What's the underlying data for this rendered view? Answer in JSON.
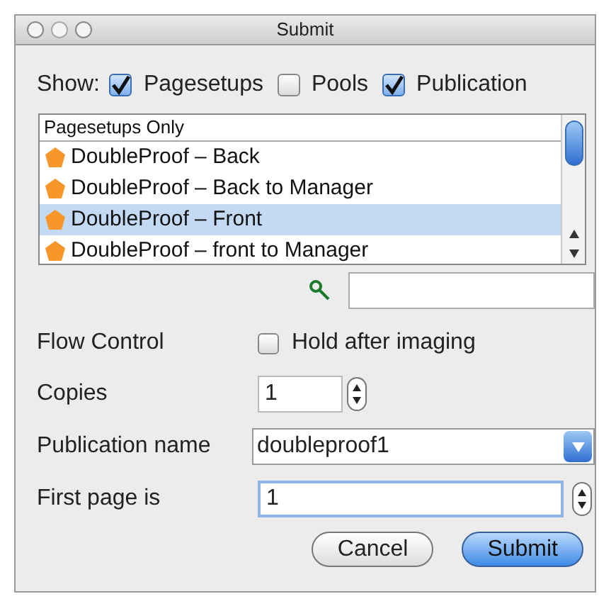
{
  "window": {
    "title": "Submit"
  },
  "show": {
    "label": "Show:",
    "options": [
      {
        "label": "Pagesetups",
        "checked": true
      },
      {
        "label": "Pools",
        "checked": false
      },
      {
        "label": "Publication",
        "checked": true
      }
    ]
  },
  "list": {
    "header": "Pagesetups Only",
    "items": [
      {
        "label": "DoubleProof – Back",
        "selected": false
      },
      {
        "label": "DoubleProof – Back to Manager",
        "selected": false
      },
      {
        "label": "DoubleProof – Front",
        "selected": true
      },
      {
        "label": "DoubleProof – front to Manager",
        "selected": false
      }
    ]
  },
  "flow_control": {
    "label": "Flow Control",
    "checkbox": {
      "label": "Hold after imaging",
      "checked": false
    }
  },
  "copies": {
    "label": "Copies",
    "value": "1"
  },
  "publication_name": {
    "label": "Publication name",
    "value": "doubleproof1"
  },
  "first_page": {
    "label": "First page is",
    "value": "1"
  },
  "buttons": [
    {
      "label": "Cancel",
      "kind": "secondary"
    },
    {
      "label": "Submit",
      "kind": "default"
    }
  ]
}
